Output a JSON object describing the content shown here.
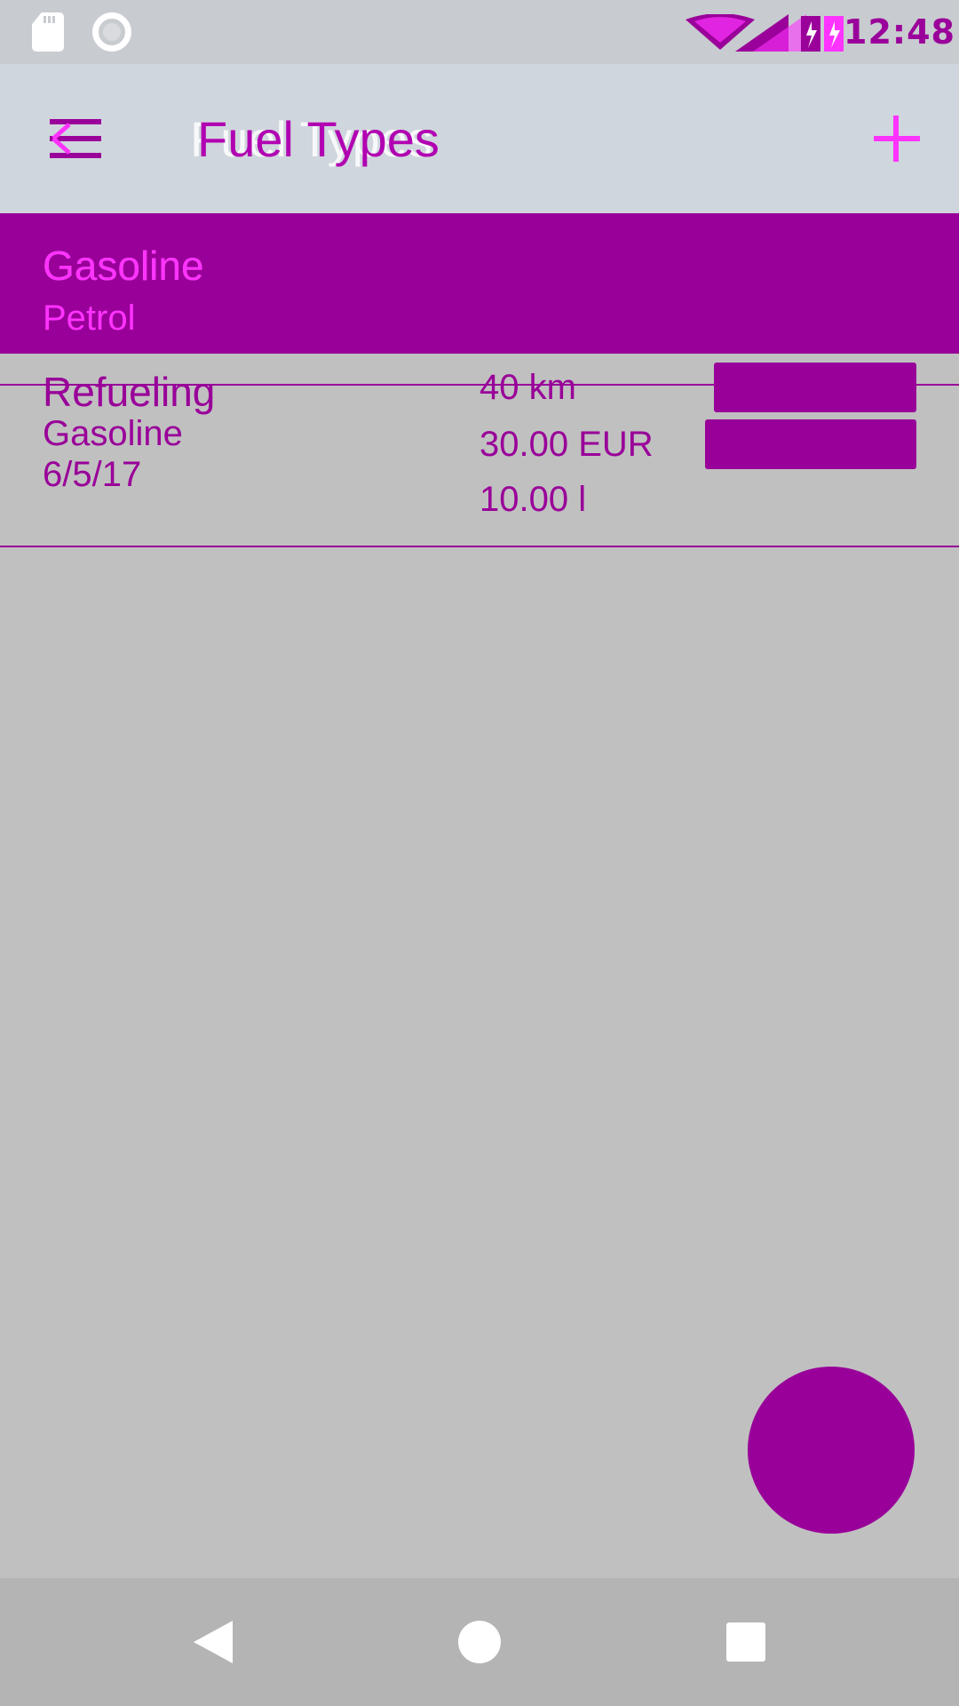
{
  "status_bar": {
    "time": "12:48",
    "icons": [
      "sd-card-icon",
      "circle-icon",
      "wifi-icon",
      "signal-icon",
      "battery-icon"
    ]
  },
  "app_bar": {
    "title": "Fuel Types",
    "menu_icon": "menu-back-icon",
    "add_icon": "plus-icon"
  },
  "fuel_type": {
    "title": "Gasoline",
    "subtitle": "Petrol"
  },
  "entry": {
    "type": "Refueling",
    "fuel": "Gasoline",
    "date": "6/5/17",
    "distance": "40 km",
    "cost": "30.00 EUR",
    "volume": "10.00 l"
  },
  "colors": {
    "accent": "#990099",
    "accent_light": "#ff33ff",
    "background": "#c0c0c0",
    "app_bar": "#cfd6dd"
  }
}
